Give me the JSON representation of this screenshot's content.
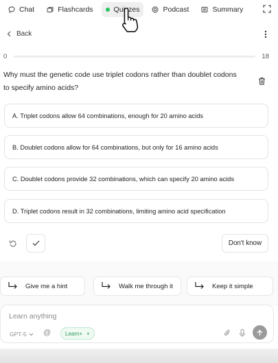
{
  "tabs": [
    {
      "label": "Chat",
      "icon": "chat-bubble-icon"
    },
    {
      "label": "Flashcards",
      "icon": "cards-icon"
    },
    {
      "label": "Quizzes",
      "icon": "status-dot-icon",
      "active": true
    },
    {
      "label": "Podcast",
      "icon": "podcast-icon"
    },
    {
      "label": "Summary",
      "icon": "list-icon"
    }
  ],
  "header": {
    "back_label": "Back"
  },
  "progress": {
    "start": "0",
    "end": "18",
    "value_fraction": 0
  },
  "question": {
    "text": "Why must the genetic code use triplet codons rather than doublet codons to specify amino acids?"
  },
  "options": [
    {
      "text": "A.  Triplet codons allow 64 combinations, enough for 20 amino acids"
    },
    {
      "text": "B.  Doublet codons allow for 64 combinations, but only for 16 amino acids"
    },
    {
      "text": "C.  Doublet codons provide 32 combinations, which can specify 20 amino acids"
    },
    {
      "text": "D.  Triplet codons result in 32 combinations, limiting amino acid specification"
    }
  ],
  "actions": {
    "dont_know_label": "Don't know"
  },
  "suggestions": [
    {
      "label": "Give me a hint"
    },
    {
      "label": "Walk me through it"
    },
    {
      "label": "Keep it simple"
    }
  ],
  "composer": {
    "placeholder": "Learn anything",
    "model": "GPT-5",
    "mode_chip": "Learn+",
    "chip_remove": "×"
  },
  "colors": {
    "accent_green": "#22c55e",
    "chip_green": "#2f9d5b",
    "border": "#e3e3e3"
  }
}
